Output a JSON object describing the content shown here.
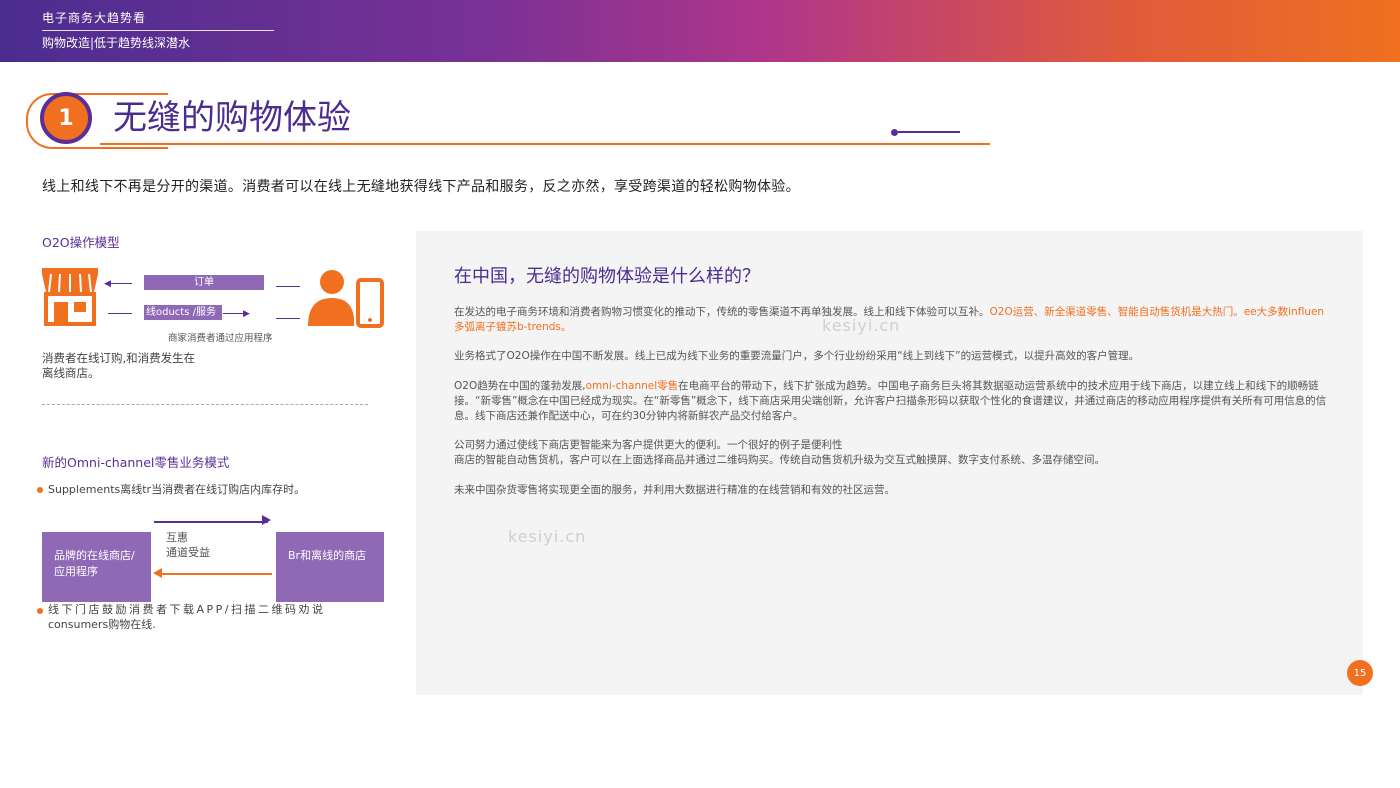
{
  "header": {
    "top_label": "电子商务大趋势看",
    "sub_label": "购物改造|低于趋势线深潜水"
  },
  "title": {
    "number": "1",
    "text": "无缝的购物体验"
  },
  "intro": "线上和线下不再是分开的渠道。消费者可以在线上无缝地获得线下产品和服务，反之亦然，享受跨渠道的轻松购物体验。",
  "o2o": {
    "title": "O2O操作模型",
    "order_label": "订单",
    "products_label": "线oducts /服务",
    "caption": "商家消费者通过应用程序",
    "desc": "消费者在线订购,和消费发生在离线商店。"
  },
  "omni": {
    "title": "新的Omni-channel零售业务模式",
    "bullet1": "Supplements离线tr当消费者在线订购店内库存时。",
    "mutual_line1": "互惠",
    "mutual_line2": "通道受益",
    "box_left": "品牌的在线商店/应用程序",
    "box_right": "Br和离线的商店",
    "bullet2_line1": "线下门店鼓励消费者下载APP/扫描二维码劝说",
    "bullet2_line2": "consumers购物在线."
  },
  "panel": {
    "title": "在中国，无缝的购物体验是什么样的？",
    "p1_a": "在发达的电子商务环境和消费者购物习惯变化的推动下，传统的零售渠道不再单独发展。线上和线下体验可以互补。",
    "p1_b": "O2O运营、新全渠道零售、智能自动售货机是大热门。ee大多数influen多弧离子镀苏b-trends。",
    "p2": "业务格式了O2O操作在中国不断发展。线上已成为线下业务的重要流量门户，多个行业纷纷采用“线上到线下”的运营模式，以提升高效的客户管理。",
    "p3_a": "O2O趋势在中国的蓬勃发展,",
    "p3_b": "omni-channel零售",
    "p3_c": "在电商平台的带动下，线下扩张成为趋势。中国电子商务巨头将其数据驱动运营系统中的技术应用于线下商店，以建立线上和线下的顺畅链接。“新零售”概念在中国已经成为现实。在“新零售”概念下，线下商店采用尖端创新，允许客户扫描条形码以获取个性化的食谱建议，并通过商店的移动应用程序提供有关所有可用信息的信息。线下商店还兼作配送中心，可在约30分钟内将新鲜农产品交付给客户。",
    "p4_line1": "公司努力通过使线下商店更智能来为客户提供更大的便利。一个很好的例子是便利性",
    "p4_line2": "商店的智能自动售货机，客户可以在上面选择商品并通过二维码购买。传统自动售货机升级为交互式触摸屏、数字支付系统、多温存储空间。",
    "p5": "未来中国杂货零售将实现更全面的服务，并利用大数据进行精准的在线营销和有效的社区运营。",
    "watermark": "kesiyi.cn"
  },
  "page_number": "15",
  "colors": {
    "purple": "#4b2d8f",
    "orange": "#f07020",
    "box": "#8f69b6"
  }
}
